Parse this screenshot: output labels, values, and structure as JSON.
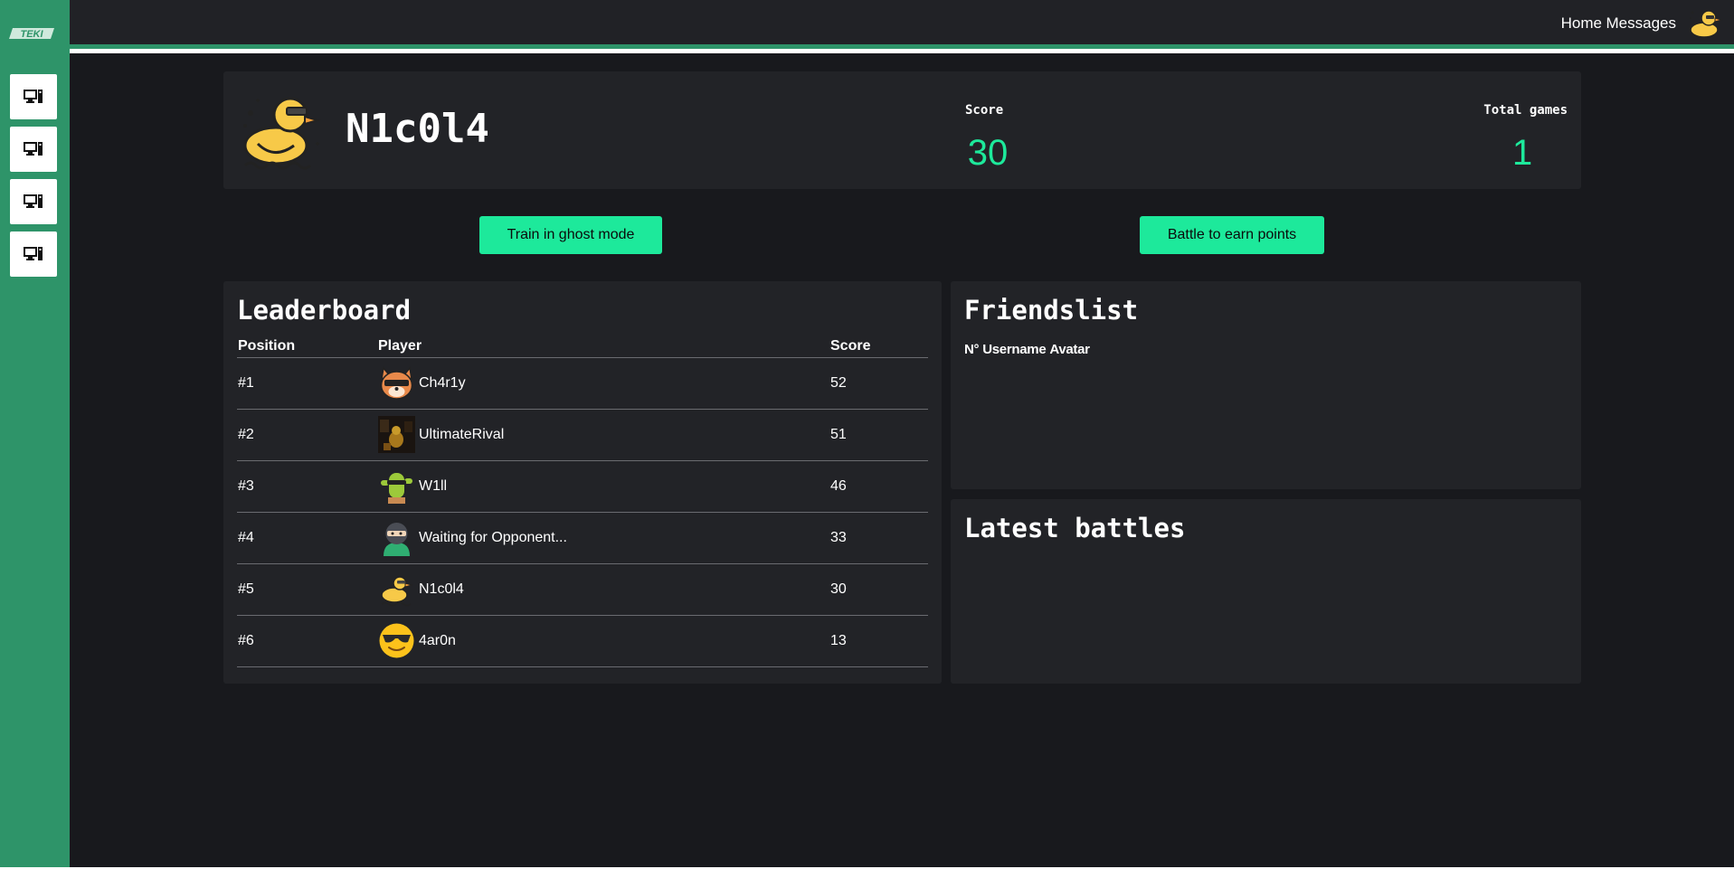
{
  "app": {
    "logo_text": "TEKI"
  },
  "sidebar": {
    "items": [
      {
        "icon": "computer-icon"
      },
      {
        "icon": "computer-icon"
      },
      {
        "icon": "computer-icon"
      },
      {
        "icon": "computer-icon"
      }
    ]
  },
  "topbar": {
    "home_label": "Home",
    "messages_label": "Messages",
    "avatar_icon": "duck-avatar-icon"
  },
  "profile": {
    "username": "N1c0l4",
    "avatar_icon": "duck-sunglasses-icon",
    "score_label": "Score",
    "score_value": "30",
    "games_label": "Total games",
    "games_value": "1"
  },
  "actions": {
    "ghost_label": "Train in ghost mode",
    "battle_label": "Battle to earn points"
  },
  "leaderboard": {
    "title": "Leaderboard",
    "headers": {
      "position": "Position",
      "player": "Player",
      "score": "Score"
    },
    "rows": [
      {
        "position": "#1",
        "player": "Ch4r1y",
        "score": "52",
        "avatar": "shiba-sunglasses-icon"
      },
      {
        "position": "#2",
        "player": "UltimateRival",
        "score": "51",
        "avatar": "dark-photo-avatar"
      },
      {
        "position": "#3",
        "player": "W1ll",
        "score": "46",
        "avatar": "cactus-sunglasses-icon"
      },
      {
        "position": "#4",
        "player": "Waiting for Opponent...",
        "score": "33",
        "avatar": "ninja-icon"
      },
      {
        "position": "#5",
        "player": "N1c0l4",
        "score": "30",
        "avatar": "duck-sunglasses-icon"
      },
      {
        "position": "#6",
        "player": "4ar0n",
        "score": "13",
        "avatar": "smiley-sunglasses-icon"
      }
    ]
  },
  "friendslist": {
    "title": "Friendslist",
    "headers": {
      "number": "N°",
      "username": "Username",
      "avatar": "Avatar"
    }
  },
  "latest_battles": {
    "title": "Latest battles"
  },
  "colors": {
    "accent": "#1de99b",
    "sidebar": "#2e9469",
    "background": "#18191d",
    "card": "#222327"
  }
}
